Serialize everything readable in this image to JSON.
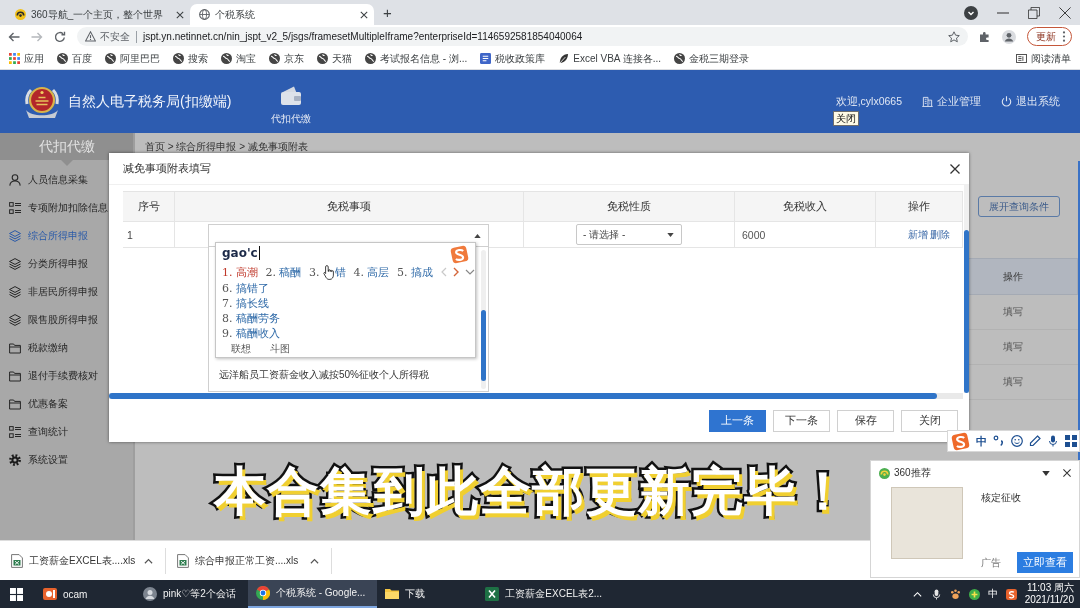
{
  "browser": {
    "tabs": [
      {
        "title": "360导航_一个主页，整个世界",
        "kind": "logo",
        "selected": false
      },
      {
        "title": "个税系统",
        "kind": "globe",
        "selected": true
      }
    ],
    "new_tab": "+",
    "address": {
      "security": "不安全",
      "url": "jspt.yn.netinnet.cn/nin_jspt_v2_5/jsgs/framesetMultipleIframe?enterpriseId=1146592581854040064"
    },
    "update_button": "更新",
    "bookmarks": [
      {
        "label": "应用",
        "kind": "apps"
      },
      {
        "label": "百度",
        "kind": "site"
      },
      {
        "label": "阿里巴巴",
        "kind": "site"
      },
      {
        "label": "搜索",
        "kind": "site"
      },
      {
        "label": "淘宝",
        "kind": "site"
      },
      {
        "label": "京东",
        "kind": "site"
      },
      {
        "label": "天猫",
        "kind": "site"
      },
      {
        "label": "考试报名信息 - 浏...",
        "kind": "site"
      },
      {
        "label": "税收政策库",
        "kind": "doc"
      },
      {
        "label": "Excel VBA 连接各...",
        "kind": "leaf"
      },
      {
        "label": "金税三期登录",
        "kind": "site"
      }
    ],
    "reading_list": "阅读清单"
  },
  "app_header": {
    "title": "自然人电子税务局(扣缴端)",
    "module": "代扣代缴",
    "welcome": "欢迎,cylx0665",
    "tooltip": "关闭",
    "links": [
      {
        "label": "企业管理",
        "kind": "enterprise"
      },
      {
        "label": "退出系统",
        "kind": "logout"
      }
    ]
  },
  "sidebar": {
    "title": "代扣代缴",
    "items": [
      {
        "label": "人员信息采集",
        "kind": "person",
        "selected": false
      },
      {
        "label": "专项附加扣除信息",
        "kind": "list",
        "selected": false
      },
      {
        "label": "综合所得申报",
        "kind": "layers",
        "selected": true
      },
      {
        "label": "分类所得申报",
        "kind": "layers",
        "selected": false
      },
      {
        "label": "非居民所得申报",
        "kind": "layers",
        "selected": false
      },
      {
        "label": "限售股所得申报",
        "kind": "layers",
        "selected": false
      },
      {
        "label": "税款缴纳",
        "kind": "folder",
        "selected": false
      },
      {
        "label": "退付手续费核对",
        "kind": "folder",
        "selected": false
      },
      {
        "label": "优惠备案",
        "kind": "folder",
        "selected": false
      },
      {
        "label": "查询统计",
        "kind": "list",
        "selected": false
      },
      {
        "label": "系统设置",
        "kind": "gear",
        "selected": false
      }
    ]
  },
  "breadcrumb": "首页 > 综合所得申报 > 减免事项附表",
  "background_table": {
    "expand_button": "展开查询条件",
    "column": "操作",
    "rows": [
      "填写",
      "填写",
      "填写"
    ]
  },
  "dialog": {
    "title": "减免事项附表填写",
    "columns": [
      "序号",
      "免税事项",
      "免税性质",
      "免税收入",
      "操作"
    ],
    "rows": [
      {
        "index": "1",
        "item": {
          "expanded": true,
          "options": [
            "远洋船员工资薪金收入减按50%征收个人所得税"
          ]
        },
        "nature": {
          "value": "- 请选择 -"
        },
        "income": "6000",
        "actions": [
          "新增",
          "删除"
        ]
      }
    ],
    "buttons": [
      {
        "label": "上一条",
        "kind": "primary"
      },
      {
        "label": "下一条",
        "kind": "default"
      },
      {
        "label": "保存",
        "kind": "default"
      },
      {
        "label": "关闭",
        "kind": "default"
      }
    ]
  },
  "ime": {
    "composition": "gao'c",
    "candidate_rows": [
      [
        {
          "number": "1.",
          "word": "高潮",
          "selected": true,
          "pointer": false
        },
        {
          "number": "2.",
          "word": "稿酬",
          "selected": false,
          "pointer": false
        },
        {
          "number": "3.",
          "word": "错",
          "selected": false,
          "pointer": true
        },
        {
          "number": "4.",
          "word": "高层",
          "selected": false,
          "pointer": false
        },
        {
          "number": "5.",
          "word": "搞成",
          "selected": false,
          "pointer": false
        }
      ],
      [
        {
          "number": "6.",
          "word": "搞错了",
          "selected": false,
          "pointer": false
        }
      ],
      [
        {
          "number": "7.",
          "word": "搞长线",
          "selected": false,
          "pointer": false
        }
      ],
      [
        {
          "number": "8.",
          "word": "稿酬劳务",
          "selected": false,
          "pointer": false
        }
      ],
      [
        {
          "number": "9.",
          "word": "稿酬收入",
          "selected": false,
          "pointer": false
        }
      ]
    ],
    "footer": [
      "联想",
      "斗图"
    ]
  },
  "ime_toolbar": {
    "mode": "中"
  },
  "caption": "本合集到此全部更新完毕！",
  "promo": {
    "title": "360推荐",
    "headline": "核定征收",
    "ad_label": "广告",
    "button": "立即查看"
  },
  "downloads": [
    {
      "filename": "工资薪金EXCEL表....xls"
    },
    {
      "filename": "综合申报正常工资....xls"
    }
  ],
  "taskbar": {
    "apps": [
      {
        "label": "ocam",
        "kind": "ocam",
        "selected": false
      },
      {
        "label": "pink♡等2个会话",
        "kind": "chat",
        "selected": false
      },
      {
        "label": "个税系统 - Google...",
        "kind": "chrome",
        "selected": true
      },
      {
        "label": "下载",
        "kind": "folder",
        "selected": false
      },
      {
        "label": "工资薪金EXCEL表2...",
        "kind": "excel",
        "selected": false
      }
    ],
    "input_mode": "中",
    "time": "11:03 周六",
    "date": "2021/11/20"
  }
}
